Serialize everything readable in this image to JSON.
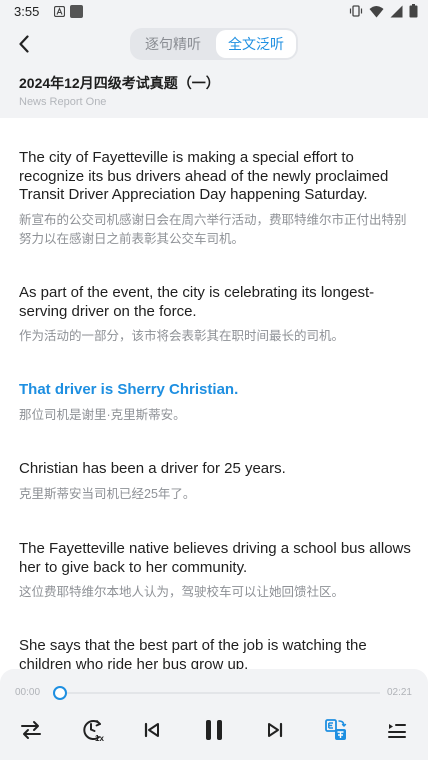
{
  "status_bar": {
    "time": "3:55"
  },
  "header": {
    "tabs": [
      {
        "label": "逐句精听",
        "active": false
      },
      {
        "label": "全文泛听",
        "active": true
      }
    ]
  },
  "title": {
    "main": "2024年12月四级考试真题（一）",
    "subtitle": "News Report One"
  },
  "sentences": [
    {
      "en": "The city of Fayetteville is making a special effort to recognize its bus drivers ahead of the newly proclaimed Transit Driver Appreciation Day happening Saturday.",
      "zh": "新宣布的公交司机感谢日会在周六举行活动，费耶特维尔市正付出特别努力以在感谢日之前表彰其公交车司机。",
      "active": false
    },
    {
      "en": "As part of the event, the city is celebrating its longest-serving driver on the force.",
      "zh": "作为活动的一部分，该市将会表彰其在职时间最长的司机。",
      "active": false
    },
    {
      "en": "That driver is Sherry Christian.",
      "zh": "那位司机是谢里·克里斯蒂安。",
      "active": true
    },
    {
      "en": "Christian has been a driver for 25 years.",
      "zh": "克里斯蒂安当司机已经25年了。",
      "active": false
    },
    {
      "en": "The Fayetteville native believes driving a school bus allows her to give back to her community.",
      "zh": "这位费耶特维尔本地人认为，驾驶校车可以让她回馈社区。",
      "active": false
    },
    {
      "en": "She says that the best part of the job is watching the children who ride her bus grow up.",
      "zh": "",
      "active": false
    }
  ],
  "player": {
    "current_time": "00:00",
    "duration": "02:21",
    "progress_fraction": 0.0,
    "speed_label": "1x",
    "accent_color": "#1e8fe1"
  },
  "colors": {
    "accent": "#1e8fe1",
    "panel_bg": "#f2f3f5"
  }
}
